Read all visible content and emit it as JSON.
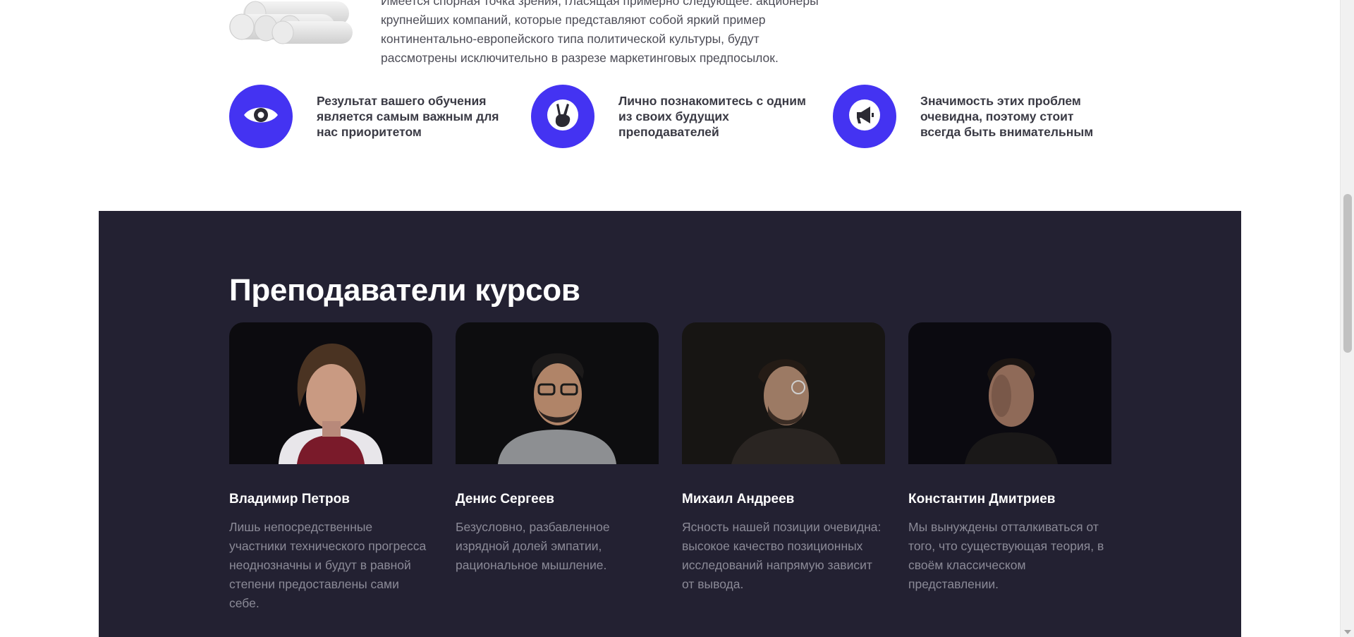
{
  "intro": {
    "lines": [
      "Имеется спорная точка зрения, гласящая примерно следующее: акционеры",
      "крупнейших компаний, которые представляют собой яркий пример",
      "континентально-европейского типа политической культуры, будут",
      "рассмотрены исключительно в разрезе маркетинговых предпосылок."
    ]
  },
  "features": [
    {
      "icon": "eye-icon",
      "text": "Результат вашего обучения является самым важным для нас приоритетом"
    },
    {
      "icon": "victory-hand-icon",
      "text": "Лично познакомитесь с одним из своих будущих преподавателей"
    },
    {
      "icon": "megaphone-icon",
      "text": "Значимость этих проблем очевидна, поэтому стоит всегда быть внимательным"
    }
  ],
  "teachers_section": {
    "title": "Преподаватели курсов",
    "teachers": [
      {
        "name": "Владимир Петров",
        "description": "Лишь непосредственные участники технического прогресса неоднозначны и будут в равной степени предоставлены сами себе."
      },
      {
        "name": "Денис Сергеев",
        "description": "Безусловно, разбавленное изрядной долей эмпатии, рациональное мышление."
      },
      {
        "name": "Михаил Андреев",
        "description": "Ясность нашей позиции очевидна: высокое качество позиционных исследований напрямую зависит от вывода."
      },
      {
        "name": "Константин Дмитриев",
        "description": "Мы вынуждены отталкиваться от того, что существующая теория, в своём классическом представлении."
      }
    ]
  },
  "colors": {
    "accent": "#4433f2",
    "dark_bg": "#232132",
    "muted_text": "#8b8a97",
    "heading_text": "#ffffff"
  }
}
